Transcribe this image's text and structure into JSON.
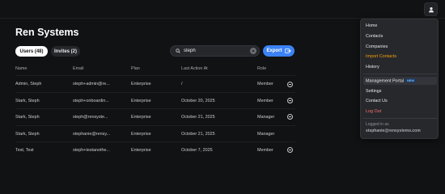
{
  "company": {
    "name": "Ren Systems"
  },
  "tabs": {
    "users": "Users (48)",
    "invites": "Invites (2)"
  },
  "search": {
    "value": "steph"
  },
  "export": {
    "label": "Export"
  },
  "table": {
    "headers": [
      "Name",
      "Email",
      "Plan",
      "Last Action At",
      "Role"
    ],
    "rows": [
      {
        "name": "Admin, Steph",
        "email": "steph+admin@re...",
        "plan": "Enterprise",
        "last_action": "/",
        "role": "Member"
      },
      {
        "name": "Stark, Steph",
        "email": "steph+onboardin...",
        "plan": "Enterprise",
        "last_action": "October 20, 2025",
        "role": "Member"
      },
      {
        "name": "Stark, Steph",
        "email": "steph@rensyste...",
        "plan": "Enterprise",
        "last_action": "October 21, 2025",
        "role": "Manager"
      },
      {
        "name": "Stark, Steph",
        "email": "stephanie@rensy...",
        "plan": "Enterprise",
        "last_action": "October 21, 2025",
        "role": "Manager"
      },
      {
        "name": "Test, Test",
        "email": "steph+testanothe...",
        "plan": "Enterprise",
        "last_action": "October 7, 2025",
        "role": "Member"
      }
    ]
  },
  "menu": {
    "items": [
      "Home",
      "Contacts",
      "Companies",
      "Import Contacts",
      "History",
      "Management Portal",
      "Settings",
      "Contact Us",
      "Log Out"
    ],
    "new_badge": "NEW",
    "logged_in_label": "Logged in as",
    "logged_in_email": "stephanie@rensystems.com"
  },
  "colors": {
    "accent": "#3b82f6",
    "import_contacts": "#f59e0b",
    "log_out": "#f87171",
    "background": "#111214"
  }
}
